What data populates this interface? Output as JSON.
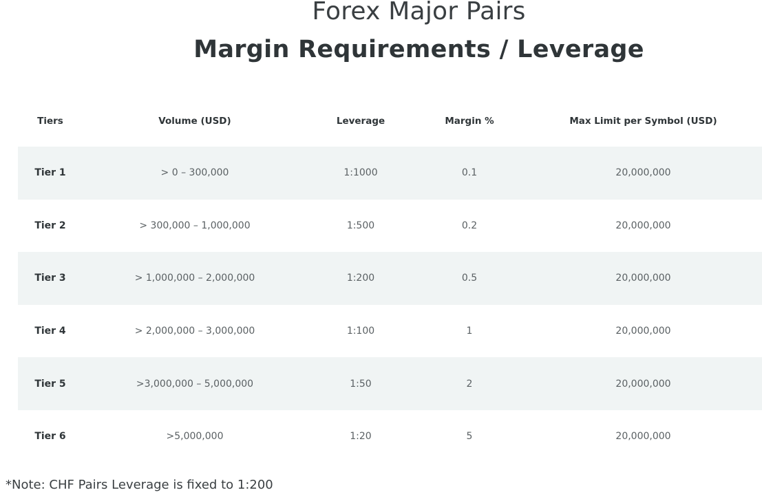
{
  "header": {
    "title": "Forex Major Pairs",
    "subtitle": "Margin Requirements / Leverage"
  },
  "table": {
    "columns": [
      "Tiers",
      "Volume (USD)",
      "Leverage",
      "Margin %",
      "Max Limit per Symbol (USD)"
    ],
    "rows": [
      [
        "Tier 1",
        "> 0 – 300,000",
        "1:1000",
        "0.1",
        "20,000,000"
      ],
      [
        "Tier 2",
        "> 300,000 – 1,000,000",
        "1:500",
        "0.2",
        "20,000,000"
      ],
      [
        "Tier 3",
        "> 1,000,000 – 2,000,000",
        "1:200",
        "0.5",
        "20,000,000"
      ],
      [
        "Tier 4",
        "> 2,000,000 – 3,000,000",
        "1:100",
        "1",
        "20,000,000"
      ],
      [
        "Tier 5",
        ">3,000,000 – 5,000,000",
        "1:50",
        "2",
        "20,000,000"
      ],
      [
        "Tier 6",
        ">5,000,000",
        "1:20",
        "5",
        "20,000,000"
      ]
    ]
  },
  "colors": {
    "shaded_row": "#f0f4f4",
    "text": "#2f3538"
  },
  "note": "*Note: CHF Pairs Leverage is fixed to 1:200"
}
